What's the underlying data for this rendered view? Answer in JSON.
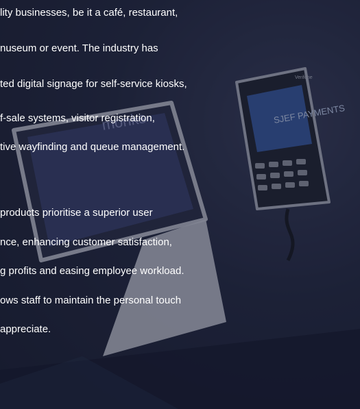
{
  "content": {
    "paragraph1": [
      "lity businesses, be it a café, restaurant,",
      "nuseum or event. The industry has",
      "ted digital signage for self-service kiosks,",
      "f-sale systems, visitor registration,",
      "tive wayfinding and queue management."
    ],
    "paragraph2": [
      "products prioritise a superior user",
      "nce, enhancing customer satisfaction,",
      "g profits and easing employee workload.",
      "ows staff to maintain the personal touch",
      "appreciate."
    ]
  },
  "device": {
    "terminal_brand": "Verifone",
    "terminal_screen_text": "SJEF PAYMENTS",
    "tablet_screen_text": "monks"
  }
}
